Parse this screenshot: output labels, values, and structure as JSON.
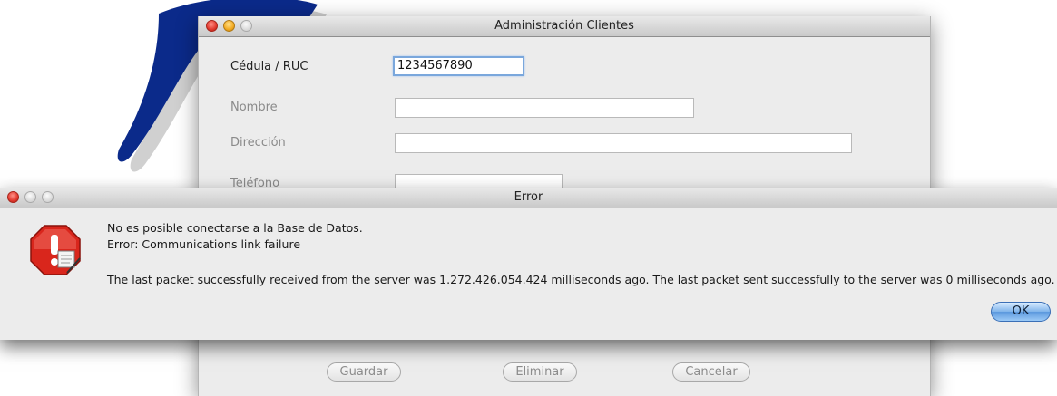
{
  "main_window": {
    "title": "Administración Clientes",
    "fields": {
      "cedula": {
        "label": "Cédula / RUC",
        "value": "1234567890"
      },
      "nombre": {
        "label": "Nombre",
        "value": ""
      },
      "direccion": {
        "label": "Dirección",
        "value": ""
      },
      "telefono": {
        "label": "Teléfono",
        "value": ""
      }
    },
    "buttons": {
      "save": "Guardar",
      "delete": "Eliminar",
      "cancel": "Cancelar"
    }
  },
  "error_dialog": {
    "title": "Error",
    "line1": "No es posible conectarse a la Base de Datos.",
    "line2": "Error: Communications link failure",
    "line3": "The last packet successfully received from the server was 1.272.426.054.424 milliseconds ago.  The last packet sent successfully to the server was 0 milliseconds ago.",
    "ok_label": "OK",
    "icon": "error-stop-sign-icon"
  },
  "colors": {
    "accent": "#5b98de",
    "error_icon_red": "#d9261c",
    "logo_blue": "#0b2a8a"
  }
}
